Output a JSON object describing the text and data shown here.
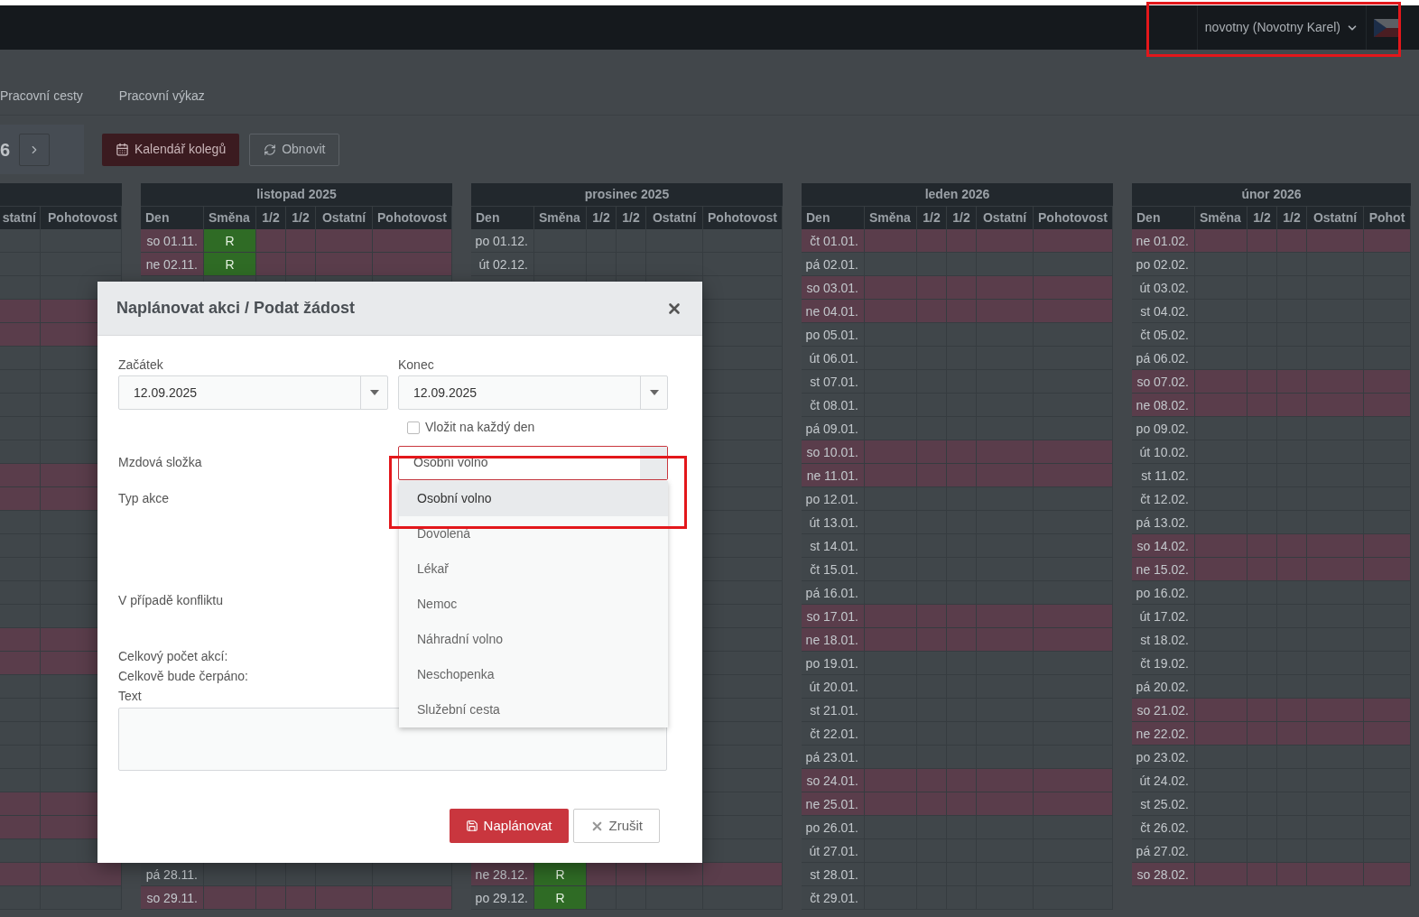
{
  "topbar": {
    "user": "novotny (Novotny Karel)"
  },
  "nav_tabs": [
    {
      "label": "Pracovní cesty"
    },
    {
      "label": "Pracovní výkaz"
    }
  ],
  "toolbar": {
    "period": "6",
    "buttons": [
      {
        "label": "Kalendář kolegů",
        "kind": "primary"
      },
      {
        "label": "Obnovit",
        "kind": "default"
      }
    ]
  },
  "calendar": {
    "partial_month": {
      "columns": [
        "statní",
        "Pohotovost"
      ],
      "rows": [
        {
          "weekend": false
        },
        {
          "weekend": false
        },
        {
          "weekend": false
        },
        {
          "weekend": true
        },
        {
          "weekend": true
        },
        {
          "weekend": false
        },
        {
          "weekend": false
        },
        {
          "weekend": false
        },
        {
          "weekend": false
        },
        {
          "weekend": false
        },
        {
          "weekend": true
        },
        {
          "weekend": true
        },
        {
          "weekend": false
        },
        {
          "weekend": false
        },
        {
          "weekend": false
        },
        {
          "weekend": false
        },
        {
          "weekend": false
        },
        {
          "weekend": true
        },
        {
          "weekend": true
        },
        {
          "weekend": false
        },
        {
          "weekend": false
        },
        {
          "weekend": false
        },
        {
          "weekend": false
        },
        {
          "weekend": false
        },
        {
          "weekend": true
        },
        {
          "weekend": true
        },
        {
          "weekend": false
        },
        {
          "weekend": true
        },
        {
          "weekend": false
        }
      ]
    },
    "months": [
      {
        "title": "listopad 2025",
        "columns": [
          "Den",
          "Směna",
          "1/2",
          "1/2",
          "Ostatní",
          "Pohotovost"
        ],
        "rows_start": [
          {
            "day": "so 01.11.",
            "weekend": true,
            "shift": "R"
          },
          {
            "day": "ne 02.11.",
            "weekend": true,
            "shift": "R"
          }
        ],
        "rows_end": [
          {
            "day": "pá 28.11.",
            "weekend": false
          },
          {
            "day": "so 29.11.",
            "weekend": true
          }
        ]
      },
      {
        "title": "prosinec 2025",
        "columns": [
          "Den",
          "Směna",
          "1/2",
          "1/2",
          "Ostatní",
          "Pohotovost"
        ],
        "rows_start": [
          {
            "day": "po 01.12.",
            "weekend": false
          },
          {
            "day": "út 02.12.",
            "weekend": false
          }
        ],
        "rows_end": [
          {
            "day": "ne 28.12.",
            "weekend": true,
            "shift": "R"
          },
          {
            "day": "po 29.12.",
            "weekend": false,
            "shift": "R"
          }
        ]
      },
      {
        "title": "leden 2026",
        "columns": [
          "Den",
          "Směna",
          "1/2",
          "1/2",
          "Ostatní",
          "Pohotovost"
        ],
        "rows_start": [
          {
            "day": "čt 01.01.",
            "weekend": true
          },
          {
            "day": "pá 02.01.",
            "weekend": false
          },
          {
            "day": "so 03.01.",
            "weekend": true
          },
          {
            "day": "ne 04.01.",
            "weekend": true
          },
          {
            "day": "po 05.01.",
            "weekend": false
          },
          {
            "day": "út 06.01.",
            "weekend": false
          },
          {
            "day": "st 07.01.",
            "weekend": false
          },
          {
            "day": "čt 08.01.",
            "weekend": false
          },
          {
            "day": "pá 09.01.",
            "weekend": false
          },
          {
            "day": "so 10.01.",
            "weekend": true
          },
          {
            "day": "ne 11.01.",
            "weekend": true
          },
          {
            "day": "po 12.01.",
            "weekend": false
          },
          {
            "day": "út 13.01.",
            "weekend": false
          },
          {
            "day": "st 14.01.",
            "weekend": false
          },
          {
            "day": "čt 15.01.",
            "weekend": false
          },
          {
            "day": "pá 16.01.",
            "weekend": false
          },
          {
            "day": "so 17.01.",
            "weekend": true
          },
          {
            "day": "ne 18.01.",
            "weekend": true
          },
          {
            "day": "po 19.01.",
            "weekend": false
          },
          {
            "day": "út 20.01.",
            "weekend": false
          },
          {
            "day": "st 21.01.",
            "weekend": false
          },
          {
            "day": "čt 22.01.",
            "weekend": false
          },
          {
            "day": "pá 23.01.",
            "weekend": false
          },
          {
            "day": "so 24.01.",
            "weekend": true
          },
          {
            "day": "ne 25.01.",
            "weekend": true
          },
          {
            "day": "po 26.01.",
            "weekend": false
          },
          {
            "day": "út 27.01.",
            "weekend": false
          },
          {
            "day": "st 28.01.",
            "weekend": false
          },
          {
            "day": "čt 29.01.",
            "weekend": false
          }
        ]
      },
      {
        "title": "únor 2026",
        "columns": [
          "Den",
          "Směna",
          "1/2",
          "1/2",
          "Ostatní",
          "Pohot"
        ],
        "rows_start": [
          {
            "day": "ne 01.02.",
            "weekend": true
          },
          {
            "day": "po 02.02.",
            "weekend": false
          },
          {
            "day": "út 03.02.",
            "weekend": false
          },
          {
            "day": "st 04.02.",
            "weekend": false
          },
          {
            "day": "čt 05.02.",
            "weekend": false
          },
          {
            "day": "pá 06.02.",
            "weekend": false
          },
          {
            "day": "so 07.02.",
            "weekend": true
          },
          {
            "day": "ne 08.02.",
            "weekend": true
          },
          {
            "day": "po 09.02.",
            "weekend": false
          },
          {
            "day": "út 10.02.",
            "weekend": false
          },
          {
            "day": "st 11.02.",
            "weekend": false
          },
          {
            "day": "čt 12.02.",
            "weekend": false
          },
          {
            "day": "pá 13.02.",
            "weekend": false
          },
          {
            "day": "so 14.02.",
            "weekend": true
          },
          {
            "day": "ne 15.02.",
            "weekend": true
          },
          {
            "day": "po 16.02.",
            "weekend": false
          },
          {
            "day": "út 17.02.",
            "weekend": false
          },
          {
            "day": "st 18.02.",
            "weekend": false
          },
          {
            "day": "čt 19.02.",
            "weekend": false
          },
          {
            "day": "pá 20.02.",
            "weekend": false
          },
          {
            "day": "so 21.02.",
            "weekend": true
          },
          {
            "day": "ne 22.02.",
            "weekend": true
          },
          {
            "day": "po 23.02.",
            "weekend": false
          },
          {
            "day": "út 24.02.",
            "weekend": false
          },
          {
            "day": "st 25.02.",
            "weekend": false
          },
          {
            "day": "čt 26.02.",
            "weekend": false
          },
          {
            "day": "pá 27.02.",
            "weekend": false
          },
          {
            "day": "so 28.02.",
            "weekend": true
          }
        ]
      }
    ]
  },
  "modal": {
    "title": "Naplánovat akci / Podat žádost",
    "start": {
      "label": "Začátek",
      "value": "12.09.2025"
    },
    "end": {
      "label": "Konec",
      "value": "12.09.2025"
    },
    "every_day": {
      "label": "Vložit na každý den",
      "checked": false
    },
    "wage_component": {
      "label": "Mzdová složka",
      "value": "Osobní volno",
      "options": [
        {
          "label": "Osobní volno",
          "selected": true
        },
        {
          "label": "Dovolená",
          "selected": false
        },
        {
          "label": "Lékař",
          "selected": false
        },
        {
          "label": "Nemoc",
          "selected": false
        },
        {
          "label": "Náhradní volno",
          "selected": false
        },
        {
          "label": "Neschopenka",
          "selected": false
        },
        {
          "label": "Služební cesta",
          "selected": false
        }
      ]
    },
    "action_type": {
      "label": "Typ akce"
    },
    "conflict": {
      "label": "V případě konfliktu"
    },
    "summary": [
      "Celkový počet akcí:",
      "Celkově bude čerpáno:"
    ],
    "text": {
      "label": "Text"
    },
    "buttons": [
      {
        "label": "Naplánovat",
        "kind": "primary"
      },
      {
        "label": "Zrušit",
        "kind": "cancel"
      }
    ]
  }
}
